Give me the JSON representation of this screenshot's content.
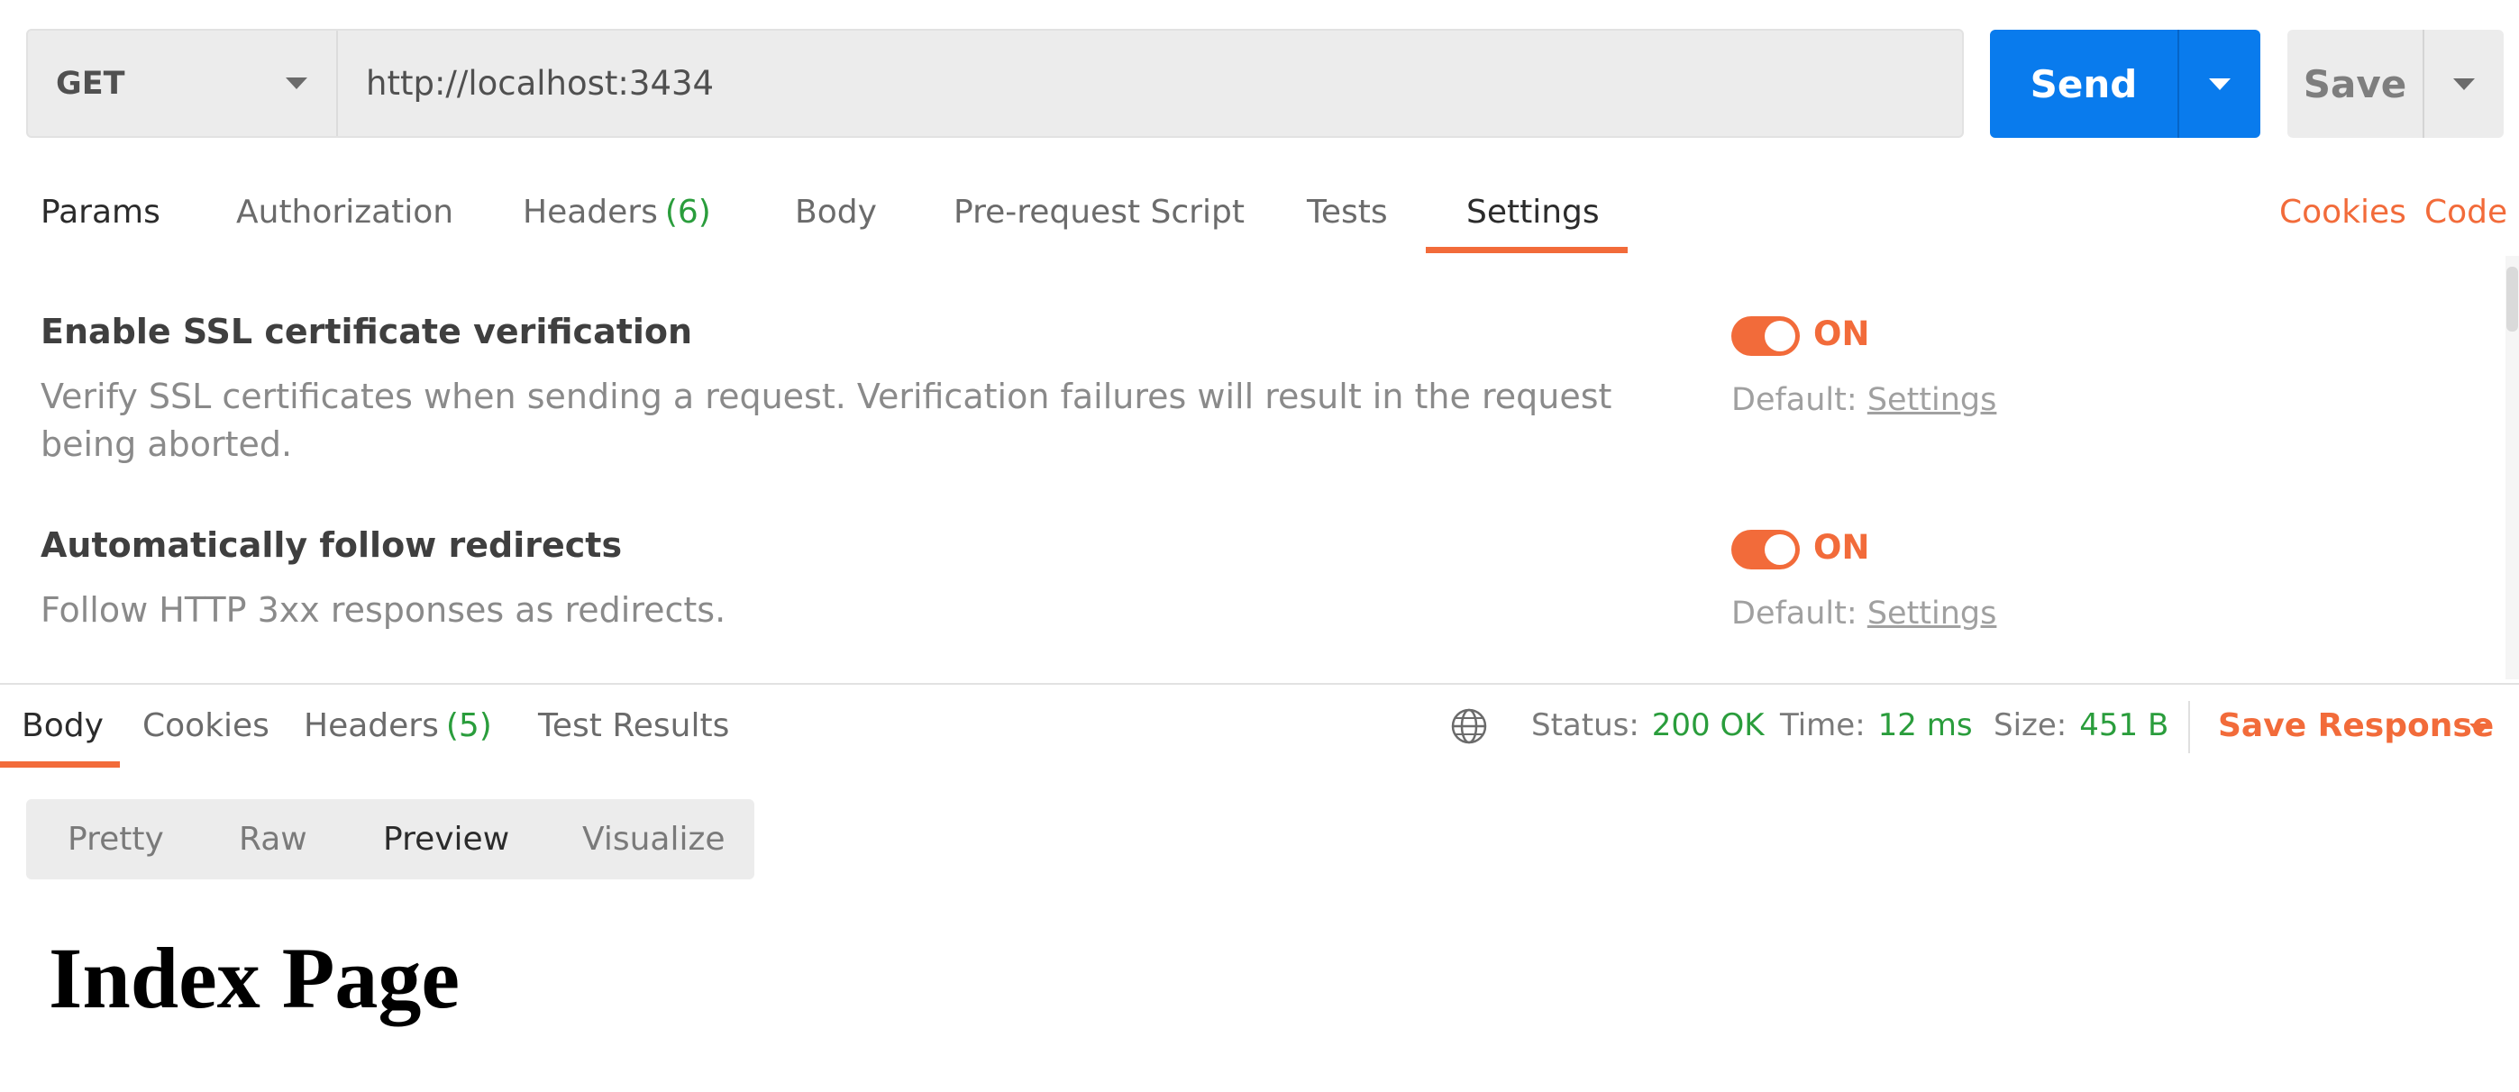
{
  "request": {
    "method": "GET",
    "url": "http://localhost:3434",
    "send_label": "Send",
    "save_label": "Save"
  },
  "request_tabs": {
    "params": "Params",
    "authorization": "Authorization",
    "headers": "Headers",
    "headers_count": "(6)",
    "body": "Body",
    "prerequest": "Pre-request Script",
    "tests": "Tests",
    "settings": "Settings",
    "cookies": "Cookies",
    "code": "Code"
  },
  "settings": {
    "items": [
      {
        "title": "Enable SSL certificate verification",
        "description": "Verify SSL certificates when sending a request. Verification failures will result in the request being aborted.",
        "state": "ON",
        "default_prefix": "Default:",
        "default_link": "Settings"
      },
      {
        "title": "Automatically follow redirects",
        "description": "Follow HTTP 3xx responses as redirects.",
        "state": "ON",
        "default_prefix": "Default:",
        "default_link": "Settings"
      }
    ]
  },
  "response_tabs": {
    "body": "Body",
    "cookies": "Cookies",
    "headers": "Headers",
    "headers_count": "(5)",
    "test_results": "Test Results"
  },
  "response_status": {
    "status_label": "Status:",
    "status_value": "200 OK",
    "time_label": "Time:",
    "time_value": "12 ms",
    "size_label": "Size:",
    "size_value": "451 B",
    "save_response": "Save Response"
  },
  "view_modes": {
    "pretty": "Pretty",
    "raw": "Raw",
    "preview": "Preview",
    "visualize": "Visualize",
    "active": "Preview"
  },
  "preview": {
    "heading": "Index Page"
  },
  "colors": {
    "accent": "#f26b3a",
    "send_blue": "#097bed",
    "success_green": "#2a9d3c"
  },
  "icons": {
    "method_caret": "chevron-down-icon",
    "send_caret": "chevron-down-icon",
    "save_caret": "chevron-down-icon",
    "environment": "globe-icon",
    "save_response_caret": "chevron-down-icon"
  }
}
